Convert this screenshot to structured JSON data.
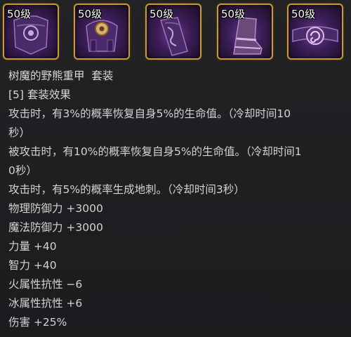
{
  "set": {
    "items": [
      {
        "level": "50级",
        "icon": "chest-armor-icon"
      },
      {
        "level": "50级",
        "icon": "shoulder-armor-icon"
      },
      {
        "level": "50级",
        "icon": "leg-armor-icon"
      },
      {
        "level": "50级",
        "icon": "boots-icon"
      },
      {
        "level": "50级",
        "icon": "belt-icon"
      }
    ],
    "title": "树魔的野熊重甲  套装",
    "effect_header": "[5] 套装效果",
    "effects": [
      "攻击时，有3%的概率恢复自身5%的生命值。（冷却时间10",
      "秒）",
      "被攻击时，有10%的概率恢复自身5%的生命值。（冷却时间1",
      "0秒）",
      "攻击时，有5%的概率生成地刺。（冷却时间3秒）"
    ],
    "stats": [
      "物理防御力 +3000",
      "魔法防御力 +3000",
      "力量 +40",
      "智力 +40",
      "火属性抗性 −6",
      "冰属性抗性 +6",
      "伤害 +25%"
    ]
  },
  "colors": {
    "slot_border": "#c99a32",
    "item_purple": "#6a3a8f",
    "text": "#d2d2d2",
    "background": "#1f1f22"
  }
}
